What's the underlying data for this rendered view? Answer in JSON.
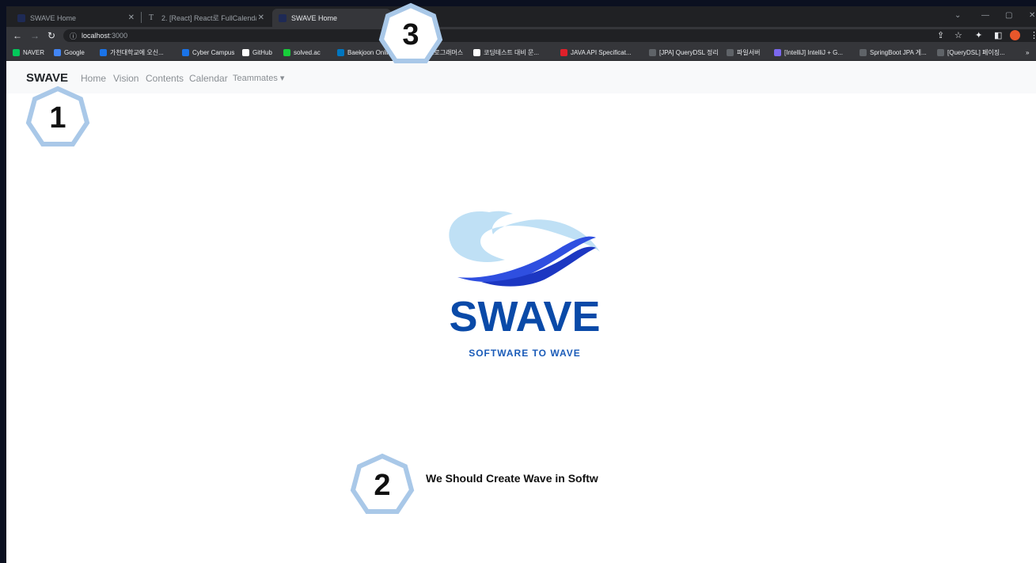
{
  "browser": {
    "tabs": [
      {
        "title": "SWAVE Home",
        "active": false
      },
      {
        "title": "2. [React] React로 FullCalendar",
        "active": false
      },
      {
        "title": "SWAVE Home",
        "active": true
      }
    ],
    "new_tab": "+",
    "address": {
      "host": "localhost",
      "port": ":3000"
    },
    "bookmarks": [
      {
        "label": "NAVER",
        "color": "#03c75a"
      },
      {
        "label": "Google",
        "color": "#4285f4"
      },
      {
        "label": "가천대학교에 오신...",
        "color": "#1a73e8"
      },
      {
        "label": "Cyber Campus",
        "color": "#1a73e8"
      },
      {
        "label": "GitHub",
        "color": "#ffffff"
      },
      {
        "label": "solved.ac",
        "color": "#17ce3a"
      },
      {
        "label": "Baekjoon Online J...",
        "color": "#0076c0"
      },
      {
        "label": "프로그래머스",
        "color": "#ffffff"
      },
      {
        "label": "코딩테스트 대비 문...",
        "color": "#ffffff"
      },
      {
        "label": "JAVA API Specificat...",
        "color": "#e0202a"
      },
      {
        "label": "[JPA] QueryDSL 정리",
        "color": "#5f6368"
      },
      {
        "label": "파일서버",
        "color": "#5f6368"
      },
      {
        "label": "[IntelliJ] IntelliJ + G...",
        "color": "#7b68ee"
      },
      {
        "label": "SpringBoot JPA 게...",
        "color": "#5f6368"
      },
      {
        "label": "[QueryDSL] 페이징...",
        "color": "#5f6368"
      }
    ],
    "more_bookmarks": "»"
  },
  "site": {
    "brand": "SWAVE",
    "nav": [
      "Home",
      "Vision",
      "Contents",
      "Calendar",
      "Teammates ▾"
    ],
    "logo_text": "SWAVE",
    "logo_subtitle": "SOFTWARE TO WAVE",
    "tagline": "We Should Create Wave in Softw"
  },
  "callouts": [
    "1",
    "2",
    "3"
  ],
  "colors": {
    "logo_blue": "#0a4aa8",
    "wave_light": "#bfe0f5",
    "wave_dark": "#1f3fd6",
    "badge_stroke": "#a9c8e8"
  }
}
